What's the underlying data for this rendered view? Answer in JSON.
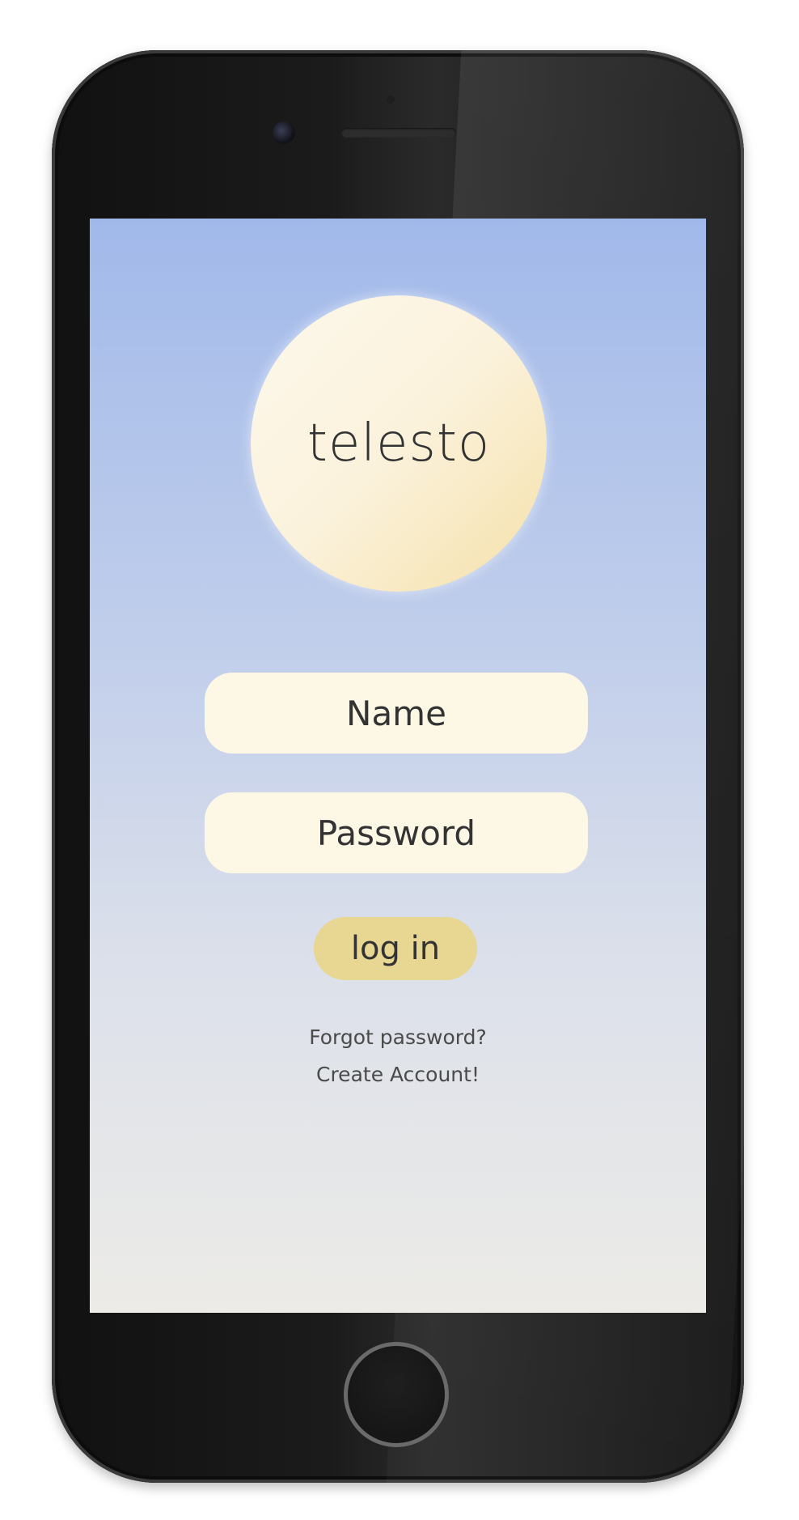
{
  "app": {
    "logo_text": "telesto"
  },
  "form": {
    "name_placeholder": "Name",
    "password_placeholder": "Password",
    "login_label": "log in"
  },
  "links": {
    "forgot_password": "Forgot password?",
    "create_account": "Create Account!"
  },
  "colors": {
    "gradient_top": "#a1b9ea",
    "gradient_bottom": "#ecebe7",
    "field_background": "#fdf7e6",
    "button_background": "#e8d693",
    "logo_circle_light": "#fdf8ec",
    "logo_circle_dark": "#f5e0a8",
    "device_body": "#111111"
  },
  "icons": {
    "camera": "camera-icon",
    "speaker": "speaker-grille-icon",
    "home": "home-button-icon"
  }
}
